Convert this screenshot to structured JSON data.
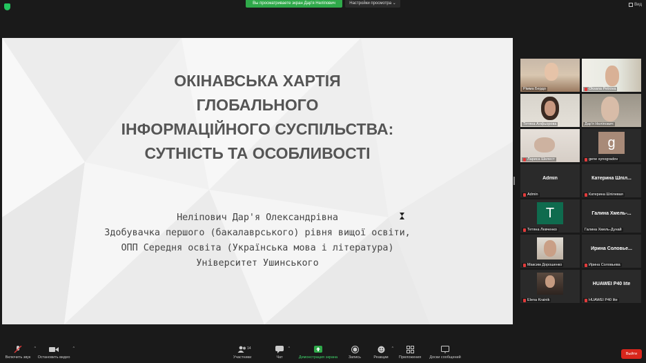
{
  "topbar": {
    "banner": "Вы просматриваете экран Дар'я Неліпович",
    "view_options": "Настройки просмотра",
    "view_button": "Вид"
  },
  "slide": {
    "title_lines": [
      "ОКІНАВСЬКА ХАРТІЯ",
      "ГЛОБАЛЬНОГО",
      "ІНФОРМАЦІЙНОГО СУСПІЛЬСТВА:",
      "СУТНІСТЬ ТА ОСОБЛИВОСТІ"
    ],
    "author_lines": [
      "Неліпович Дар'я Олександрівна",
      "Здобувачка першого (бакалаврського) рівня вищої освіти,",
      "ОПП Середня освіта (Українська мова і література)",
      "Університет Ушинського"
    ]
  },
  "gallery": {
    "participants": [
      {
        "name": "Рімма Бердо",
        "muted": false
      },
      {
        "name": "Oksana Petrova",
        "muted": true
      },
      {
        "name": "Тетяна Алфьорова",
        "muted": false
      },
      {
        "name": "Дар'я Неліпович",
        "muted": false
      },
      {
        "name": "Лариса Шелест",
        "muted": true
      },
      {
        "name": "gene synogradov",
        "muted": true,
        "avatar": "g"
      },
      {
        "name": "Admin",
        "muted": true,
        "big": "Admin"
      },
      {
        "name": "Катерина Шпілевая",
        "muted": true,
        "big": "Катерина Шпіл..."
      },
      {
        "name": "Тетяна Левченко",
        "muted": true,
        "avatar": "T"
      },
      {
        "name": "Галина Хмель-Дунай",
        "muted": false,
        "big": "Галина Хмель-..."
      },
      {
        "name": "Максим Дорошенко",
        "muted": true
      },
      {
        "name": "Ирина Соловьева",
        "muted": true,
        "big": "Ирина Соловье..."
      },
      {
        "name": "Elena Krainik",
        "muted": true
      },
      {
        "name": "HUAWEI P40 lite",
        "muted": true,
        "big": "HUAWEI P40 lite"
      }
    ]
  },
  "toolbar": {
    "audio": "Включить звук",
    "video": "Остановить видео",
    "participants": "Участники",
    "participants_count": "14",
    "chat": "Чат",
    "share": "Демонстрация экрана",
    "record": "Запись",
    "reactions": "Реакции",
    "apps": "Приложения",
    "whiteboards": "Доски сообщений",
    "leave": "Выйти"
  },
  "colors": {
    "accent_green": "#2fa94a",
    "leave_red": "#d9261c",
    "speaker_outline": "#b8d84a"
  }
}
